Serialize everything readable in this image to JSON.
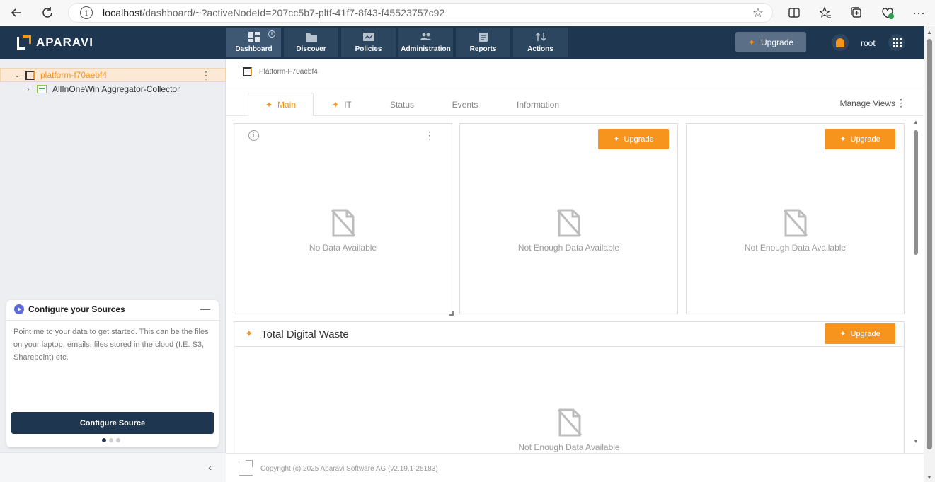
{
  "browser": {
    "url_host": "localhost",
    "url_rest": "/dashboard/~?activeNodeId=207cc5b7-pltf-41f7-8f43-f45523757c92"
  },
  "app": {
    "brand": "APARAVI",
    "nav": [
      {
        "label": "Dashboard",
        "icon": "dashboard-icon"
      },
      {
        "label": "Discover",
        "icon": "folder-icon"
      },
      {
        "label": "Policies",
        "icon": "policies-icon"
      },
      {
        "label": "Administration",
        "icon": "users-icon"
      },
      {
        "label": "Reports",
        "icon": "clipboard-icon"
      },
      {
        "label": "Actions",
        "icon": "actions-icon"
      }
    ],
    "upgrade_label": "Upgrade",
    "user": "root",
    "accent": "#f7941d",
    "header_bg": "#1e3650"
  },
  "sidebar": {
    "tree": [
      {
        "label": "platform-f70aebf4",
        "selected": true
      },
      {
        "label": "AllInOneWin Aggregator-Collector",
        "selected": false
      }
    ],
    "card": {
      "title": "Configure your Sources",
      "body": "Point me to your data to get started. This can be the files on your laptop, emails, files stored in the cloud (I.E. S3, Sharepoint) etc.",
      "button": "Configure Source",
      "pages": 3,
      "current_page": 1
    }
  },
  "main": {
    "breadcrumb": "Platform-F70aebf4",
    "tabs": [
      "Main",
      "IT",
      "Status",
      "Events",
      "Information"
    ],
    "active_tab": "Main",
    "manage_views": "Manage Views",
    "panels": [
      {
        "message": "No Data Available"
      },
      {
        "message": "Not Enough Data Available",
        "button": "Upgrade"
      },
      {
        "message": "Not Enough Data Available",
        "button": "Upgrade"
      }
    ],
    "waste": {
      "title": "Total Digital Waste",
      "button": "Upgrade",
      "message": "Not Enough Data Available"
    },
    "footer": "Copyright (c) 2025 Aparavi Software AG (v2.19.1-25183)"
  }
}
